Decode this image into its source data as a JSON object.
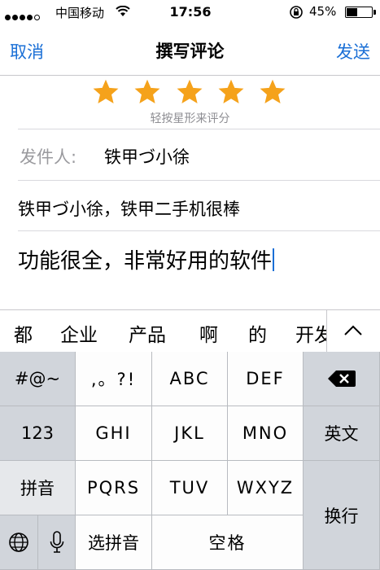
{
  "status_bar": {
    "carrier": "中国移动",
    "time": "17:56",
    "battery": "45%",
    "battery_level": 0.45
  },
  "nav": {
    "cancel": "取消",
    "title": "撰写评论",
    "send": "发送"
  },
  "rating": {
    "stars": 5,
    "selected": 5,
    "star_color": "#f5a21b",
    "hint": "轻按星形来评分"
  },
  "form": {
    "sender_label": "发件人:",
    "sender_value": "铁甲づ小徐",
    "title_value": "铁甲づ小徐，铁甲二手机很棒",
    "content_value": "功能很全，非常好用的软件"
  },
  "candidates": [
    "都",
    "企业",
    "产品",
    "啊",
    "的",
    "开发"
  ],
  "keyboard": {
    "symbols": "#@~",
    "punct": ",。?!",
    "abc": "ABC",
    "def": "DEF",
    "num": "123",
    "ghi": "GHI",
    "jkl": "JKL",
    "mno": "MNO",
    "english": "英文",
    "pinyin": "拼音",
    "pqrs": "PQRS",
    "tuv": "TUV",
    "wxyz": "WXYZ",
    "return": "换行",
    "select_pinyin": "选拼音",
    "space": "空格"
  },
  "colors": {
    "accent": "#1a6fd6",
    "caret": "#1a6fd6"
  }
}
